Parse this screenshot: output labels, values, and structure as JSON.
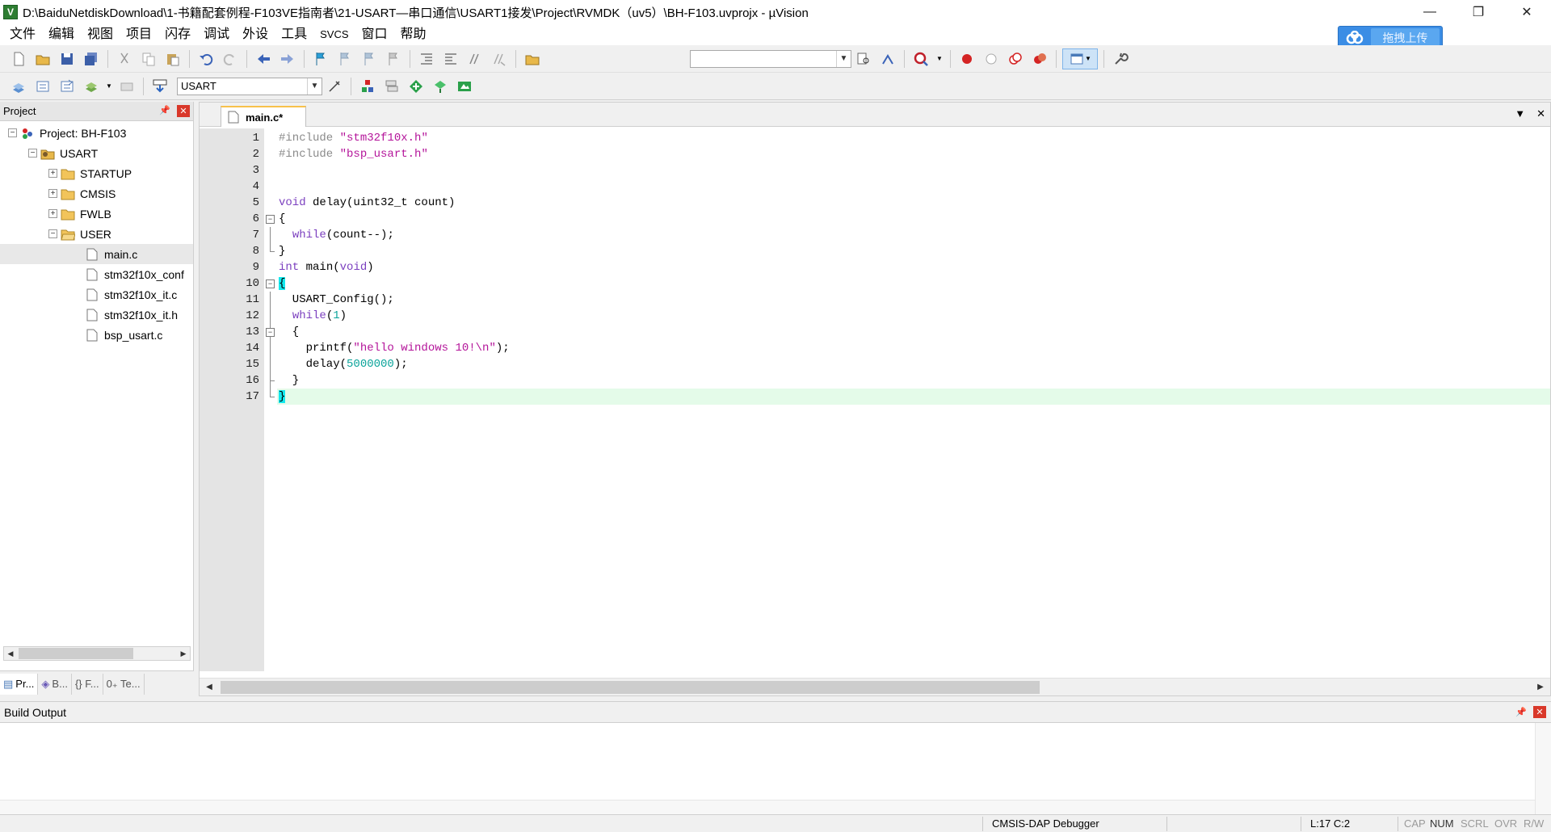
{
  "window": {
    "title": "D:\\BaiduNetdiskDownload\\1-书籍配套例程-F103VE指南者\\21-USART—串口通信\\USART1接发\\Project\\RVMDK（uv5）\\BH-F103.uvprojx - µVision",
    "minimize": "—",
    "restore": "❐",
    "close": "✕"
  },
  "menu": [
    "文件",
    "编辑",
    "视图",
    "项目",
    "闪存",
    "调试",
    "外设",
    "工具",
    "SVCS",
    "窗口",
    "帮助"
  ],
  "upload_button": "拖拽上传",
  "toolbar2": {
    "target_combo": "USART"
  },
  "project": {
    "title": "Project",
    "root": "Project: BH-F103",
    "target": "USART",
    "groups": [
      "STARTUP",
      "CMSIS",
      "FWLB",
      "USER"
    ],
    "files": [
      "main.c",
      "stm32f10x_conf",
      "stm32f10x_it.c",
      "stm32f10x_it.h",
      "bsp_usart.c"
    ],
    "tabs": [
      "Pr...",
      "B...",
      "{} F...",
      "0₊ Te..."
    ]
  },
  "editor": {
    "tab_label": "main.c*",
    "code_lines": [
      "#include \"stm32f10x.h\"",
      "#include \"bsp_usart.h\"",
      "",
      "",
      "void delay(uint32_t count)",
      "{",
      "  while(count--);",
      "}",
      "int main(void)",
      "{",
      "  USART_Config();",
      "  while(1)",
      "  {",
      "    printf(\"hello windows 10!\\n\");",
      "    delay(5000000);",
      "  }",
      "}"
    ],
    "line_numbers": [
      "1",
      "2",
      "3",
      "4",
      "5",
      "6",
      "7",
      "8",
      "9",
      "10",
      "11",
      "12",
      "13",
      "14",
      "15",
      "16",
      "17"
    ],
    "current_line": 17
  },
  "build_output": {
    "title": "Build Output"
  },
  "status": {
    "debugger": "CMSIS-DAP Debugger",
    "position": "L:17 C:2",
    "indicators": [
      "CAP",
      "NUM",
      "SCRL",
      "OVR",
      "R/W"
    ]
  },
  "colors": {
    "keyword": "#7b3fbf",
    "string": "#b4149a",
    "number": "#0aa39a",
    "current_line_bg": "#e4fbe9",
    "brace_highlight": "#13e9ee"
  }
}
